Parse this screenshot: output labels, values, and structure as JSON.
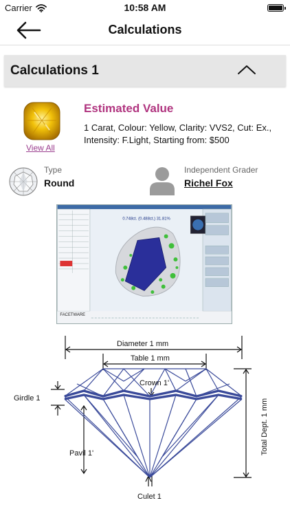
{
  "status_bar": {
    "carrier": "Carrier",
    "time": "10:58 AM"
  },
  "nav": {
    "title": "Calculations",
    "back_icon": "arrow-left-icon"
  },
  "section": {
    "title": "Calculations 1",
    "toggle_icon": "chevron-up-icon"
  },
  "estimate": {
    "title": "Estimated Value",
    "description": "1 Carat, Colour: Yellow, Clarity: VVS2, Cut: Ex., Intensity: F.Light,  Starting from: $500",
    "view_all": "View All",
    "accent_color": "#b0347f",
    "link_color": "#9a3c8d"
  },
  "details": {
    "type_label": "Type",
    "type_value": "Round",
    "grader_label": "Independent Grader",
    "grader_value": "Richel Fox"
  },
  "scan_image": {
    "header_text": "0.748ct. (0.488ct.) 31.81%",
    "brand": "FACETWARE"
  },
  "diagram": {
    "diameter": "Diameter 1 mm",
    "table": "Table 1 mm",
    "crown": "Crown 1'",
    "girdle": "Girdle 1",
    "pavil": "Pavil 1'",
    "culet": "Culet 1",
    "total_depth": "Total Dept. 1 mm",
    "line_color": "#3a4a9a"
  }
}
